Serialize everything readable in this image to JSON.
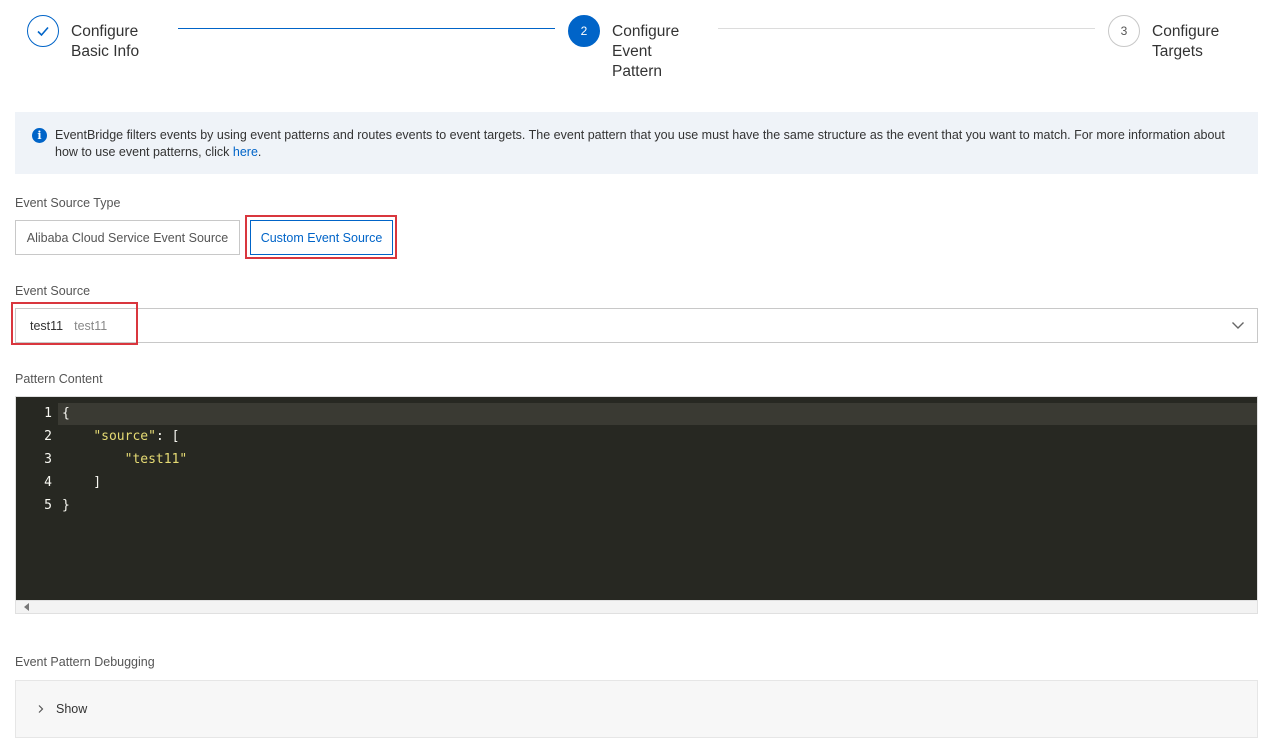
{
  "steps": [
    {
      "number": "",
      "title": "Configure Basic Info",
      "status": "done"
    },
    {
      "number": "2",
      "title": "Configure Event Pattern",
      "status": "active"
    },
    {
      "number": "3",
      "title": "Configure Targets",
      "status": "todo"
    }
  ],
  "info": {
    "text": "EventBridge filters events by using event patterns and routes events to event targets. The event pattern that you use must have the same structure as the event that you want to match. For more information about how to use event patterns, click ",
    "link": "here",
    "end": "."
  },
  "source_type": {
    "label": "Event Source Type",
    "options": [
      "Alibaba Cloud Service Event Source",
      "Custom Event Source"
    ],
    "selected": "Custom Event Source"
  },
  "event_source": {
    "label": "Event Source",
    "value": "test11",
    "description": "test11"
  },
  "pattern": {
    "label": "Pattern Content",
    "line_numbers": [
      "1",
      "2",
      "3",
      "4",
      "5"
    ],
    "lines": [
      "{",
      "    \"source\": [",
      "        \"test11\"",
      "    ]",
      "}"
    ]
  },
  "debugging": {
    "label": "Event Pattern Debugging",
    "toggle": "Show"
  },
  "colors": {
    "accent": "#0064c8",
    "highlight_box": "#d9363e",
    "editor_bg": "#272822",
    "string": "#e6db74"
  }
}
